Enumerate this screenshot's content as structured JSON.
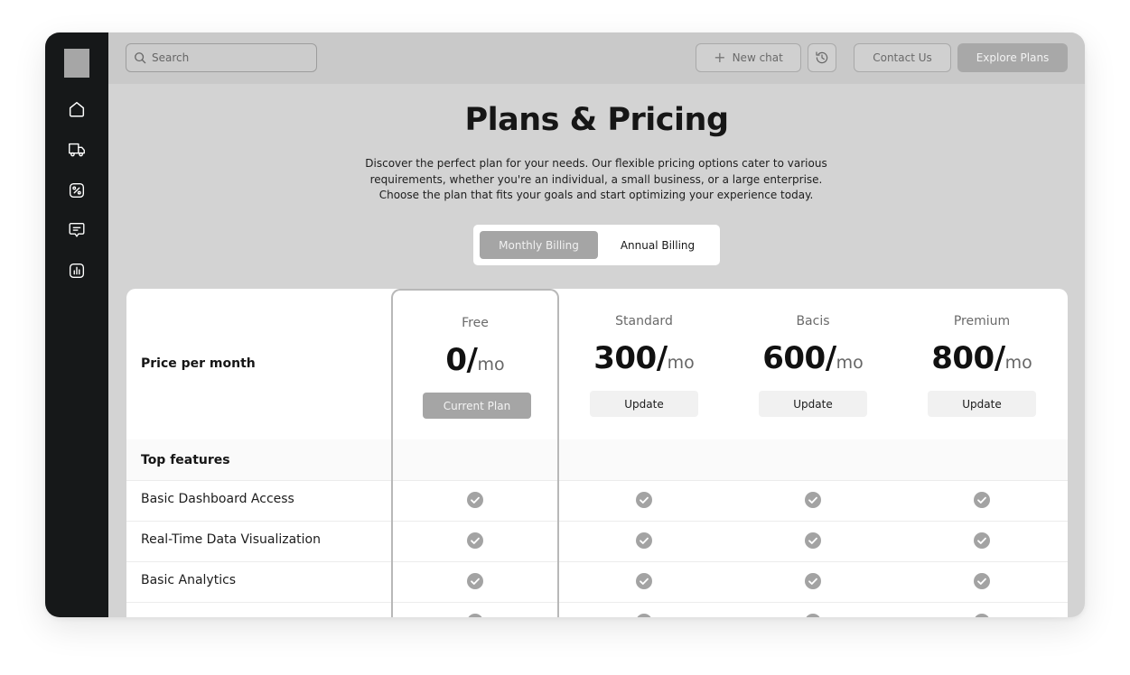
{
  "search": {
    "placeholder": "Search"
  },
  "header": {
    "new_chat_label": "New chat",
    "contact_label": "Contact Us",
    "explore_label": "Explore Plans"
  },
  "sidebar": {
    "icons": [
      "home-icon",
      "truck-icon",
      "discount-icon",
      "message-icon",
      "chart-icon"
    ]
  },
  "page": {
    "title": "Plans & Pricing",
    "subtitle_lines": [
      "Discover the perfect plan for your needs. Our flexible pricing options cater to various",
      "requirements, whether you're an individual, a small business, or a large enterprise.",
      "Choose the plan that fits your goals and start optimizing your experience today."
    ]
  },
  "billing_toggle": {
    "monthly": "Monthly Billing",
    "annual": "Annual Billing",
    "selected": "monthly"
  },
  "table": {
    "price_label": "Price per month",
    "features_title": "Top features",
    "plans": [
      {
        "name": "Free",
        "amount": "0/",
        "unit": "mo",
        "button": "Current Plan",
        "current": true
      },
      {
        "name": "Standard",
        "amount": "300/",
        "unit": "mo",
        "button": "Update",
        "current": false
      },
      {
        "name": "Bacis",
        "amount": "600/",
        "unit": "mo",
        "button": "Update",
        "current": false
      },
      {
        "name": "Premium",
        "amount": "800/",
        "unit": "mo",
        "button": "Update",
        "current": false
      }
    ],
    "features": [
      {
        "label": "Basic Dashboard Access",
        "included": [
          true,
          true,
          true,
          true
        ]
      },
      {
        "label": "Real-Time Data Visualization",
        "included": [
          true,
          true,
          true,
          true
        ]
      },
      {
        "label": "Basic Analytics",
        "included": [
          true,
          true,
          true,
          true
        ]
      }
    ]
  },
  "colors": {
    "sidebar": "#161819",
    "background": "#d3d3d3",
    "accent_gray": "#a5a5a5",
    "check": "#a3a3a3"
  }
}
